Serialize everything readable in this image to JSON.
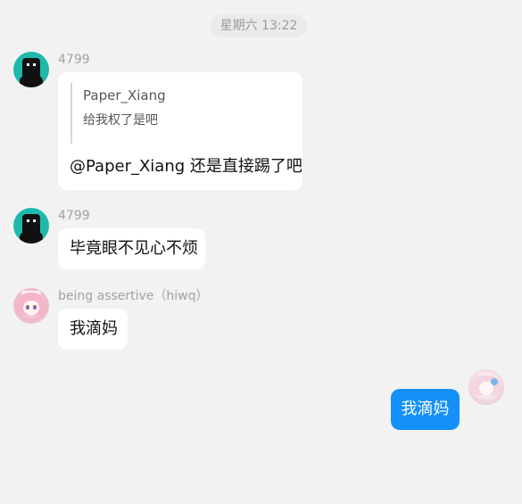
{
  "chat": {
    "timestamp": "星期六 13:22",
    "messages": [
      {
        "sender": "4799",
        "quote_author": "Paper_Xiang",
        "quote_text": "给我权了是吧",
        "text": "@Paper_Xiang 还是直接踢了吧"
      },
      {
        "sender": "4799",
        "text": "毕竟眼不见心不烦"
      },
      {
        "sender": "being assertive（hiwq）",
        "text": "我滴妈"
      }
    ],
    "self_message": "我滴妈"
  },
  "icons": {
    "avatar_4799": "pixel-avatar-icon",
    "avatar_being_assertive": "anime-avatar-icon",
    "avatar_self": "anime-avatar-icon"
  },
  "colors": {
    "background": "#f2f2f2",
    "incoming_bubble": "#ffffff",
    "outgoing_bubble": "#1391f8",
    "timestamp_bg": "#ebebeb",
    "muted_text": "#a2a2a2"
  }
}
